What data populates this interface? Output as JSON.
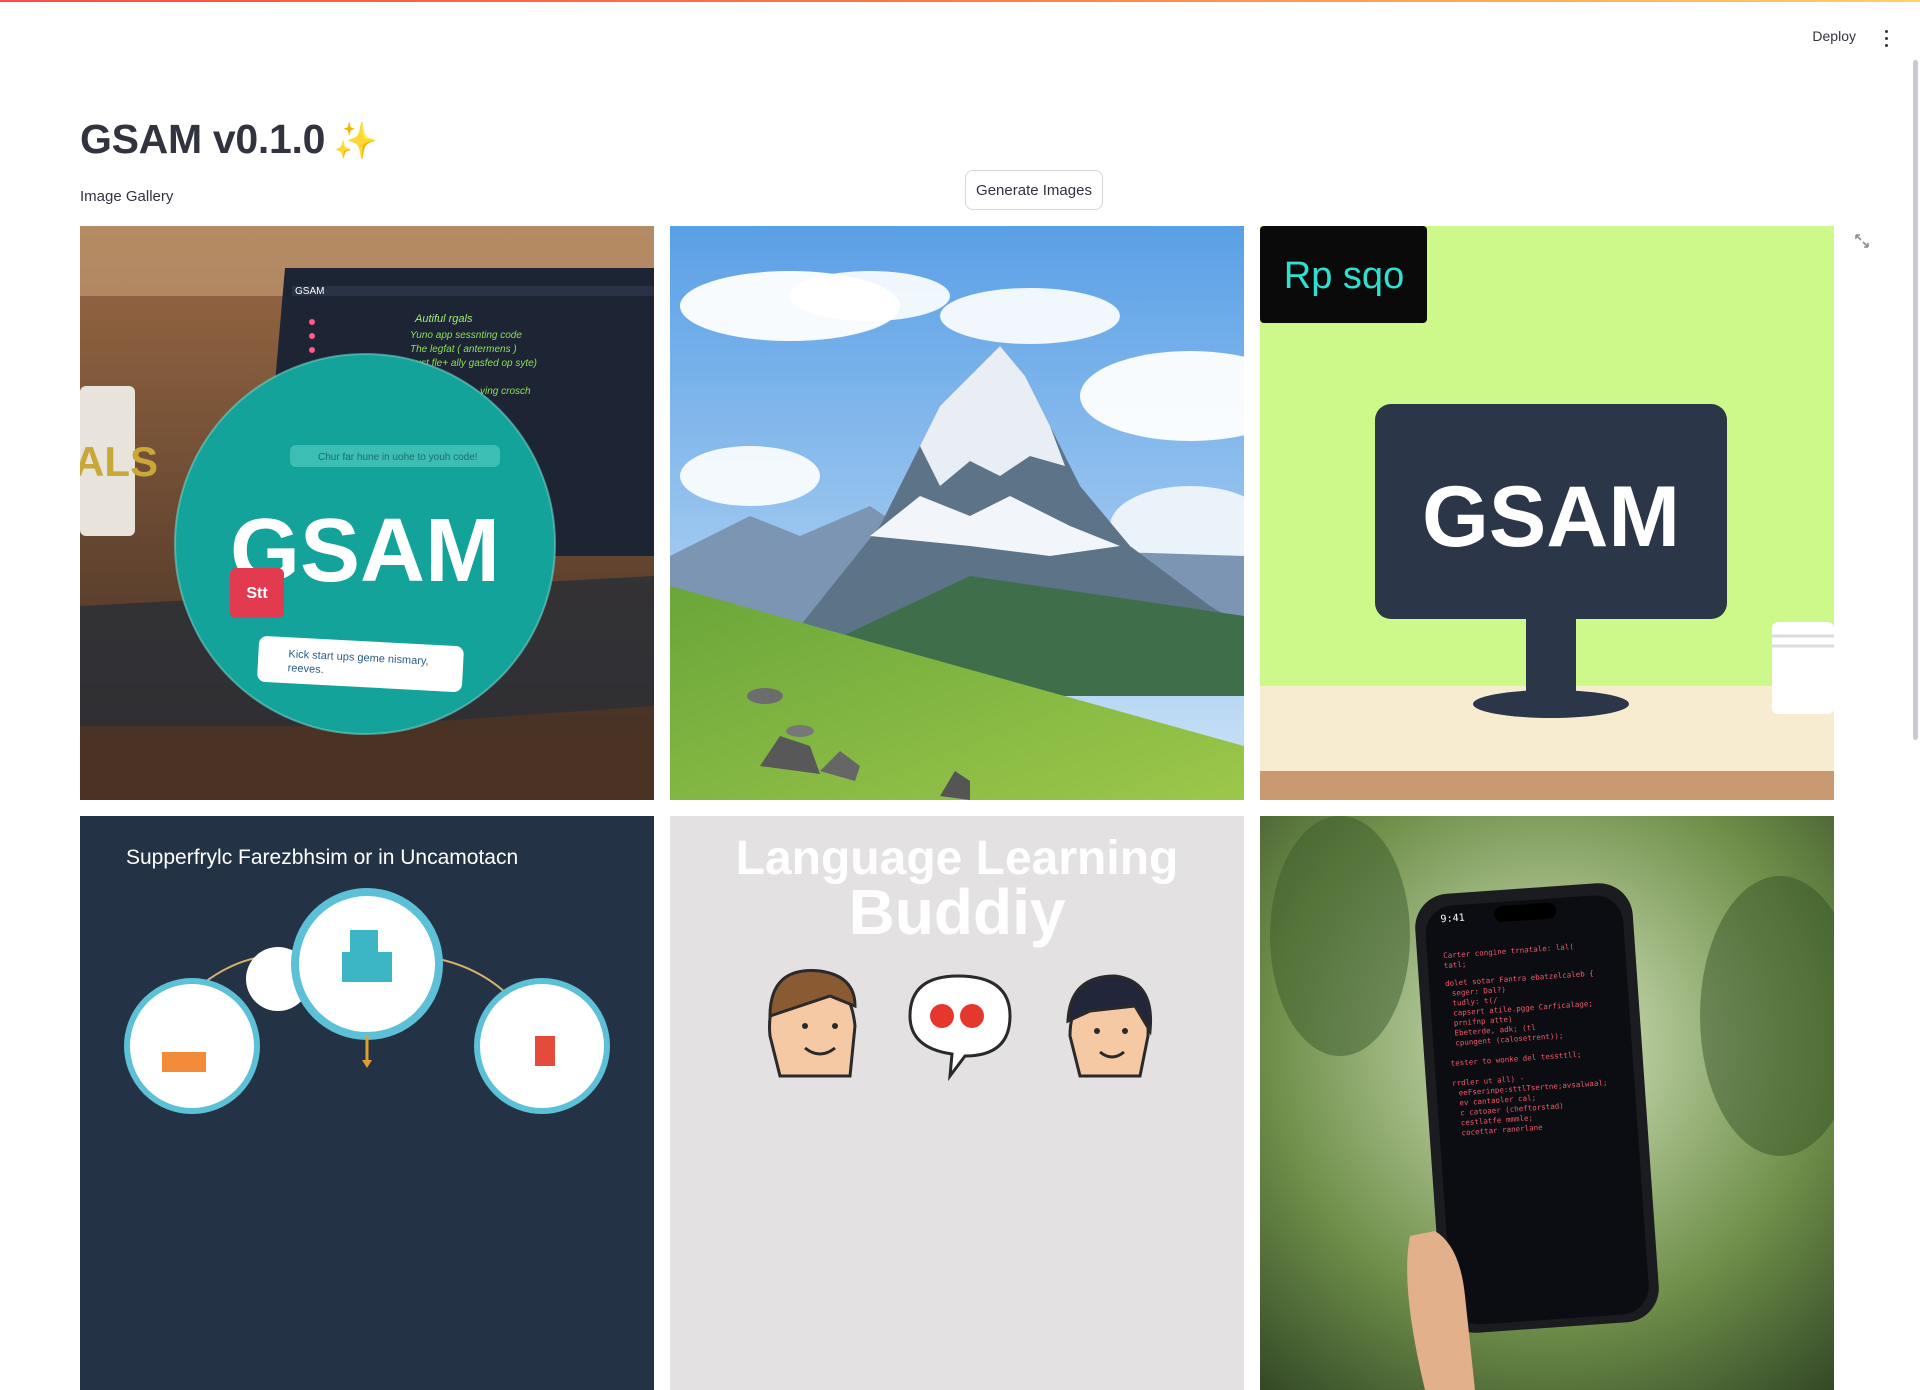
{
  "app": {
    "deploy_label": "Deploy",
    "menu_icon": "vertical-dots-icon"
  },
  "page": {
    "title": "GSAM v0.1.0",
    "title_emoji": "✨",
    "subtitle": "Image Gallery",
    "generate_label": "Generate Images",
    "fullscreen_icon": "expand-icon"
  },
  "gallery": {
    "tiles": [
      {
        "overlay_heading": "GSAM",
        "badge_text": "Stt",
        "pill_text": "Kick start ups geme nismary, reeves.",
        "screen_lines": [
          "GSAM",
          "Autiful rgals",
          "Yuno app sessnting code",
          "The legfat ( antermens )",
          "gust fle+ ally gasfed op syte)",
          "ving crosch",
          "Chur far hune in uohe to youh code!"
        ],
        "mug_text": "ALS"
      },
      {
        "overlay_heading": ""
      },
      {
        "corner_label": "Rp sqo",
        "monitor_text": "GSAM"
      },
      {
        "heading": "Supperfrylc Farezbhsim or in Uncamotacn"
      },
      {
        "heading_line1": "Language Learning",
        "heading_line2": "Buddiy"
      },
      {
        "phone_time": "9:41",
        "code_lines": [
          "Carter congine trnatale: lal(",
          "tatl;",
          "dolet sotar Fantra ebatzelcaleb {",
          "  seger: Dal?)",
          "  tudly: t(/",
          "  capsert atile.pgge Carficalage;",
          "  prnifnp atte)",
          "  Ebeterde, adk;   (tl",
          "  cpungent (calosetrent));",
          "tester to wonke del tessttll;",
          "rrdler ut all) -",
          "  eeFserinpe:sttlTsertne;avsalwaal;",
          "  ev cantaoler cal;",
          "  c catoaer (cheftorstad)",
          "  cestlatfe mmmle;",
          "  cocettar ranerlane"
        ]
      }
    ]
  },
  "colors": {
    "text": "#31333f",
    "accent_gradient": [
      "#ff4b4b",
      "#ffd166"
    ],
    "teal": "#13a39a",
    "lime": "#ccf98a",
    "navy": "#2b3648"
  }
}
